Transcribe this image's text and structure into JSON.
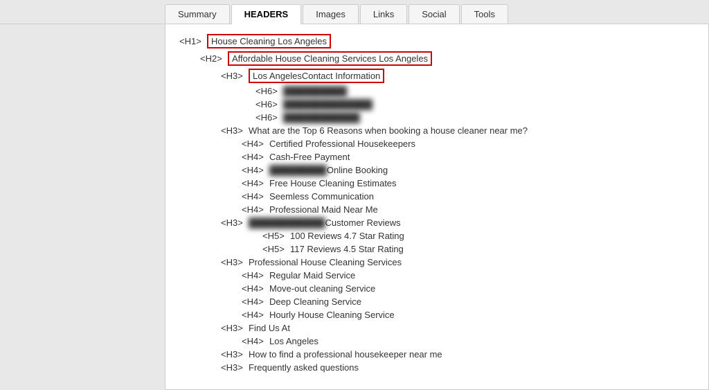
{
  "tabs": [
    {
      "id": "summary",
      "label": "Summary",
      "active": false
    },
    {
      "id": "headers",
      "label": "HEADERS",
      "active": true
    },
    {
      "id": "images",
      "label": "Images",
      "active": false
    },
    {
      "id": "links",
      "label": "Links",
      "active": false
    },
    {
      "id": "social",
      "label": "Social",
      "active": false
    },
    {
      "id": "tools",
      "label": "Tools",
      "active": false
    }
  ],
  "headers": [
    {
      "level": "H1",
      "indent": "h1-line",
      "highlighted": true,
      "text": "House Cleaning Los Angeles",
      "blurred_prefix": null,
      "blurred_suffix": null
    },
    {
      "level": "H2",
      "indent": "h2-line",
      "highlighted": true,
      "text": "Affordable House Cleaning Services Los Angeles",
      "blurred_prefix": null,
      "blurred_suffix": null
    },
    {
      "level": "H3",
      "indent": "h3-line",
      "highlighted": true,
      "text": "Los AngelesContact Information",
      "blurred_prefix": null,
      "blurred_suffix": null
    },
    {
      "level": "H6",
      "indent": "h6-line",
      "highlighted": false,
      "text": "",
      "blurred_prefix": "blurred1",
      "blurred_suffix": null
    },
    {
      "level": "H6",
      "indent": "h6-line",
      "highlighted": false,
      "text": "",
      "blurred_prefix": "blurred2",
      "blurred_suffix": null
    },
    {
      "level": "H6",
      "indent": "h6-line",
      "highlighted": false,
      "text": "",
      "blurred_prefix": "blurred3",
      "blurred_suffix": null
    },
    {
      "level": "H3",
      "indent": "h3-line",
      "highlighted": false,
      "text": "What are the Top 6 Reasons when booking a house cleaner near me?",
      "blurred_prefix": null,
      "blurred_suffix": null
    },
    {
      "level": "H4",
      "indent": "h4-line",
      "highlighted": false,
      "text": "Certified Professional Housekeepers",
      "blurred_prefix": null,
      "blurred_suffix": null
    },
    {
      "level": "H4",
      "indent": "h4-line",
      "highlighted": false,
      "text": "Cash-Free Payment",
      "blurred_prefix": null,
      "blurred_suffix": null
    },
    {
      "level": "H4",
      "indent": "h4-line",
      "highlighted": false,
      "text": " Online Booking",
      "blurred_prefix": "blurred4",
      "blurred_suffix": null
    },
    {
      "level": "H4",
      "indent": "h4-line",
      "highlighted": false,
      "text": "Free House Cleaning Estimates",
      "blurred_prefix": null,
      "blurred_suffix": null
    },
    {
      "level": "H4",
      "indent": "h4-line",
      "highlighted": false,
      "text": "Seemless Communication",
      "blurred_prefix": null,
      "blurred_suffix": null
    },
    {
      "level": "H4",
      "indent": "h4-line",
      "highlighted": false,
      "text": "Professional Maid Near Me",
      "blurred_prefix": null,
      "blurred_suffix": null
    },
    {
      "level": "H3",
      "indent": "h3-line",
      "highlighted": false,
      "text": " Customer Reviews",
      "blurred_prefix": "blurred5",
      "blurred_suffix": null
    },
    {
      "level": "H5",
      "indent": "h5-line",
      "highlighted": false,
      "text": "100 Reviews 4.7 Star Rating",
      "blurred_prefix": null,
      "blurred_suffix": null
    },
    {
      "level": "H5",
      "indent": "h5-line",
      "highlighted": false,
      "text": "117 Reviews 4.5 Star Rating",
      "blurred_prefix": null,
      "blurred_suffix": null
    },
    {
      "level": "H3",
      "indent": "h3-line",
      "highlighted": false,
      "text": "Professional House Cleaning Services",
      "blurred_prefix": null,
      "blurred_suffix": null
    },
    {
      "level": "H4",
      "indent": "h4-line",
      "highlighted": false,
      "text": "Regular Maid Service",
      "blurred_prefix": null,
      "blurred_suffix": null
    },
    {
      "level": "H4",
      "indent": "h4-line",
      "highlighted": false,
      "text": "Move-out cleaning Service",
      "blurred_prefix": null,
      "blurred_suffix": null
    },
    {
      "level": "H4",
      "indent": "h4-line",
      "highlighted": false,
      "text": "Deep Cleaning Service",
      "blurred_prefix": null,
      "blurred_suffix": null
    },
    {
      "level": "H4",
      "indent": "h4-line",
      "highlighted": false,
      "text": "Hourly House Cleaning Service",
      "blurred_prefix": null,
      "blurred_suffix": null
    },
    {
      "level": "H3",
      "indent": "h3-line",
      "highlighted": false,
      "text": "Find Us At",
      "blurred_prefix": null,
      "blurred_suffix": null
    },
    {
      "level": "H4",
      "indent": "h4-line",
      "highlighted": false,
      "text": "Los Angeles",
      "blurred_prefix": null,
      "blurred_suffix": null
    },
    {
      "level": "H3",
      "indent": "h3-line",
      "highlighted": false,
      "text": "How to find a professional housekeeper near me",
      "blurred_prefix": null,
      "blurred_suffix": null
    },
    {
      "level": "H3",
      "indent": "h3-line",
      "highlighted": false,
      "text": "Frequently asked questions",
      "blurred_prefix": null,
      "blurred_suffix": null
    }
  ],
  "blurred_items": {
    "blurred1": "██████████",
    "blurred2": "██████████████",
    "blurred3": "████████████",
    "blurred4": "█████████",
    "blurred5": "████████████"
  }
}
